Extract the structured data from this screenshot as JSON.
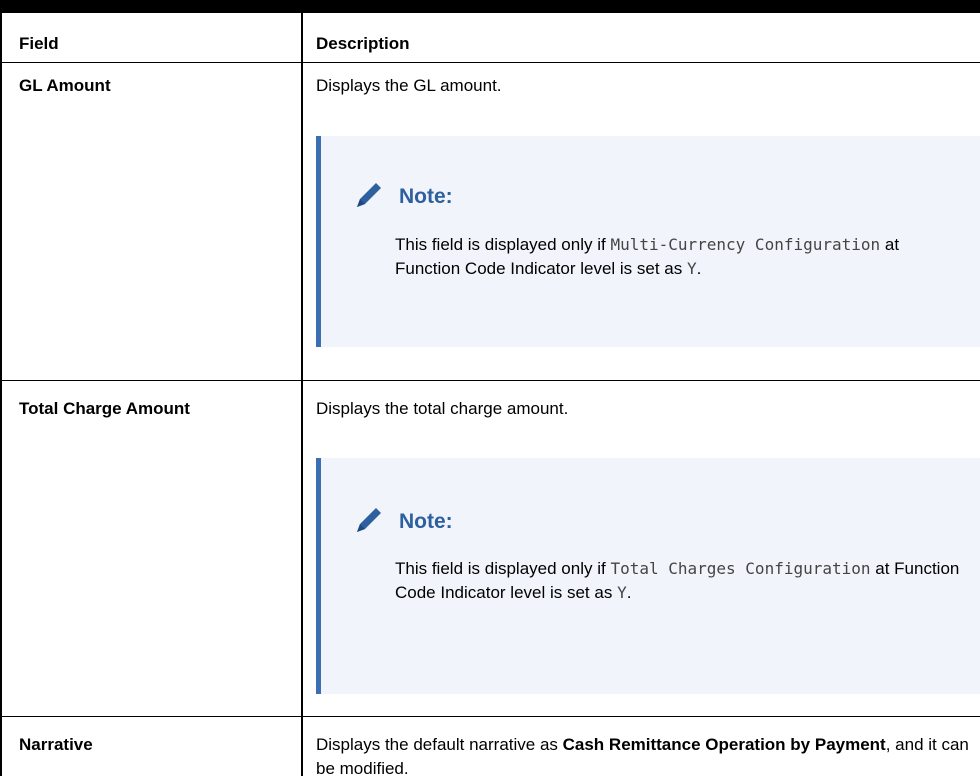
{
  "table": {
    "header": {
      "field": "Field",
      "description": "Description"
    },
    "rows": [
      {
        "field": "GL Amount",
        "description": "Displays the GL amount.",
        "note": {
          "title": "Note:",
          "text_a": "This field is displayed only if ",
          "code_a": "Multi-Currency Configuration",
          "text_b": " at Function Code Indicator level is set as ",
          "code_b": "Y",
          "text_c": "."
        }
      },
      {
        "field": "Total Charge Amount",
        "description": "Displays the total charge amount.",
        "note": {
          "title": "Note:",
          "text_a": "This field is displayed only if ",
          "code_a": "Total Charges Configuration",
          "text_b": " at Function Code Indicator level is set as ",
          "code_b": "Y",
          "text_c": "."
        }
      },
      {
        "field": "Narrative",
        "description_a": "Displays the default narrative as ",
        "description_bold": "Cash Remittance Operation by Payment",
        "description_b": ", and it can be modified."
      }
    ]
  },
  "colors": {
    "note_accent": "#3a6fb3",
    "note_bg": "#f1f5fb",
    "note_title": "#2e5f9e"
  },
  "icons": {
    "note_icon": "pencil-icon"
  }
}
